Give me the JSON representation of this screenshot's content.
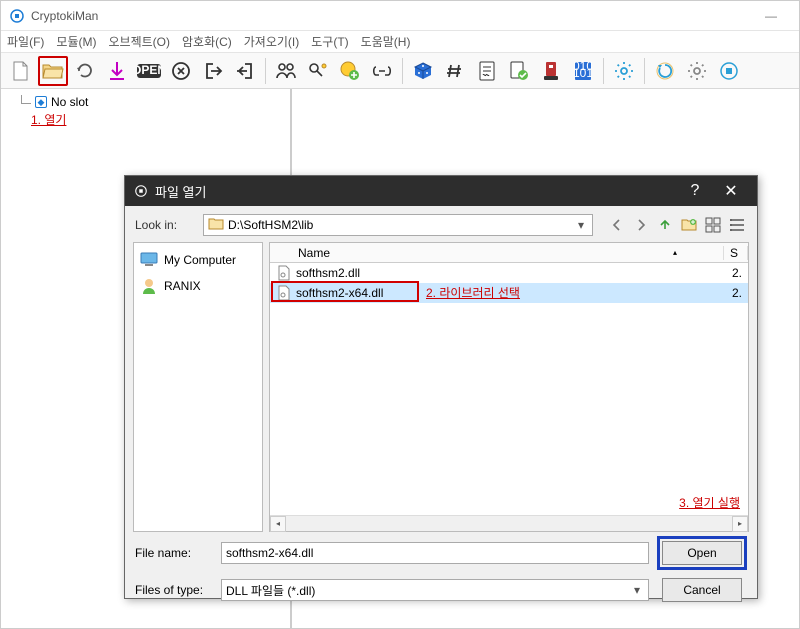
{
  "app": {
    "title": "CryptokiMan"
  },
  "menu": {
    "file": "파일(F)",
    "module": "모듈(M)",
    "object": "오브젝트(O)",
    "crypto": "암호화(C)",
    "import": "가져오기(I)",
    "tool": "도구(T)",
    "help": "도움말(H)"
  },
  "tree": {
    "no_slot": "No slot"
  },
  "annotations": {
    "a1": "1. 열기",
    "a2": "2. 라이브러리 선택",
    "a3": "3. 열기 실행"
  },
  "dialog": {
    "title": "파일 열기",
    "look_in_label": "Look in:",
    "look_in_path": "D:\\SoftHSM2\\lib",
    "col_name": "Name",
    "col_s": "S",
    "sidebar": {
      "my_computer": "My Computer",
      "ranix": "RANIX"
    },
    "rows": [
      {
        "name": "softhsm2.dll",
        "s": "2."
      },
      {
        "name": "softhsm2-x64.dll",
        "s": "2."
      }
    ],
    "file_name_label": "File name:",
    "file_name_value": "softhsm2-x64.dll",
    "files_of_type_label": "Files of type:",
    "files_of_type_value": "DLL 파일들 (*.dll)",
    "open_btn": "Open",
    "cancel_btn": "Cancel"
  }
}
